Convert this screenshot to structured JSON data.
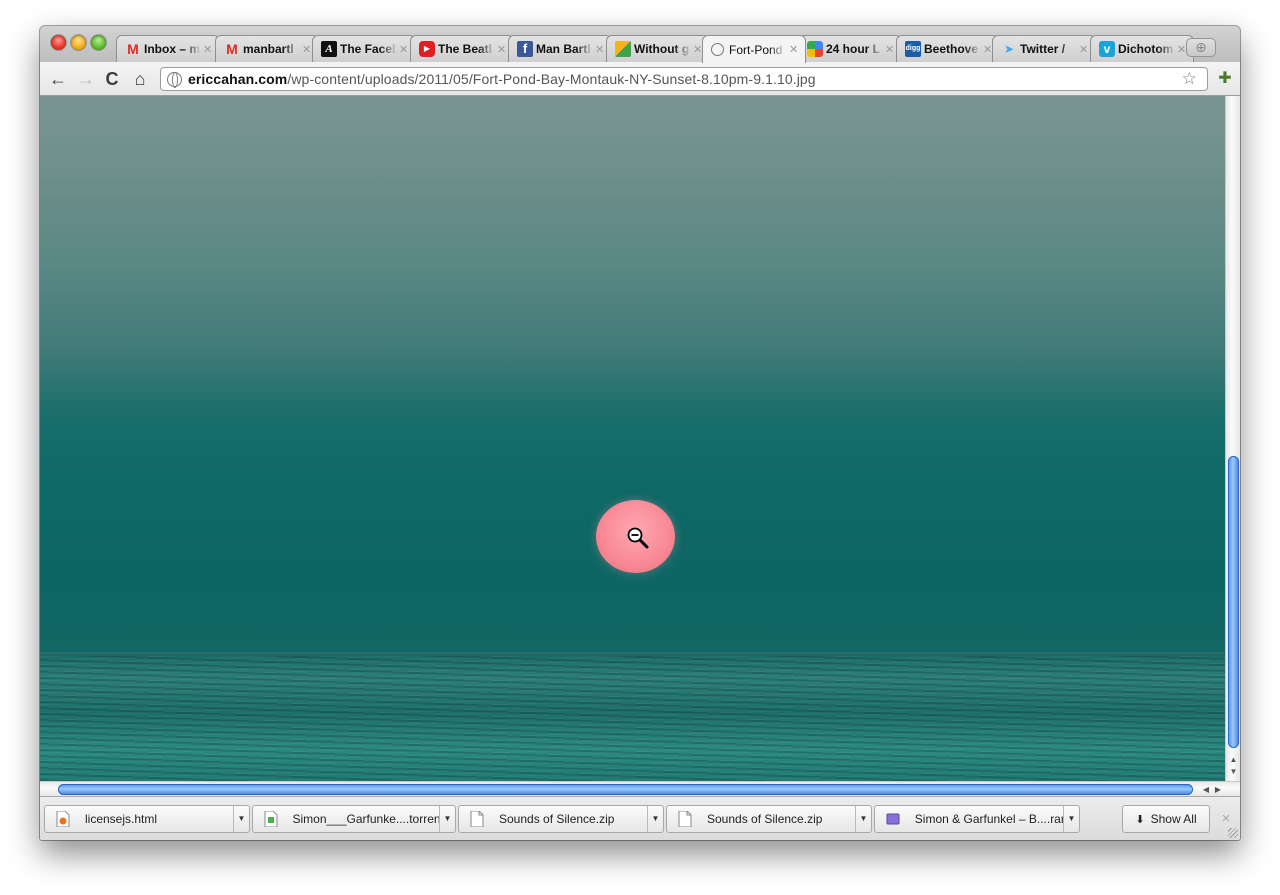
{
  "tabs": [
    {
      "title": "Inbox – m",
      "favicon": "gmail-icon",
      "active": false
    },
    {
      "title": "manbartl",
      "favicon": "gmail-icon",
      "active": false
    },
    {
      "title": "The Faceb",
      "favicon": "atlantic-icon",
      "active": false
    },
    {
      "title": "The Beatl",
      "favicon": "youtube-icon",
      "active": false
    },
    {
      "title": "Man Bartl",
      "favicon": "facebook-icon",
      "active": false
    },
    {
      "title": "Without g",
      "favicon": "brochure-icon",
      "active": false
    },
    {
      "title": "Fort-Pond",
      "favicon": "globe-icon",
      "active": true
    },
    {
      "title": "24 hour L",
      "favicon": "google-icon",
      "active": false
    },
    {
      "title": "Beethove",
      "favicon": "digg-icon",
      "active": false
    },
    {
      "title": "Twitter /",
      "favicon": "twitter-icon",
      "active": false
    },
    {
      "title": "Dichotom",
      "favicon": "vimeo-icon",
      "active": false
    }
  ],
  "toolbar": {
    "url_domain": "ericcahan.com",
    "url_path": "/wp-content/uploads/2011/05/Fort-Pond-Bay-Montauk-NY-Sunset-8.10pm-9.1.10.jpg"
  },
  "downloads": [
    {
      "name": "licensejs.html",
      "icon": "html-file-icon"
    },
    {
      "name": "Simon___Garfunke....torrent",
      "icon": "torrent-file-icon"
    },
    {
      "name": "Sounds of Silence.zip",
      "icon": "zip-file-icon"
    },
    {
      "name": "Sounds of Silence.zip",
      "icon": "zip-file-icon"
    },
    {
      "name": "Simon & Garfunkel – B....rar",
      "icon": "rar-file-icon"
    }
  ],
  "shelf": {
    "show_all_label": "Show All"
  },
  "colors": {
    "sun": "#f88894",
    "sea": "#1f7a72",
    "sky_top": "#7a9591",
    "scroll_thumb": "#4a8fe8"
  }
}
